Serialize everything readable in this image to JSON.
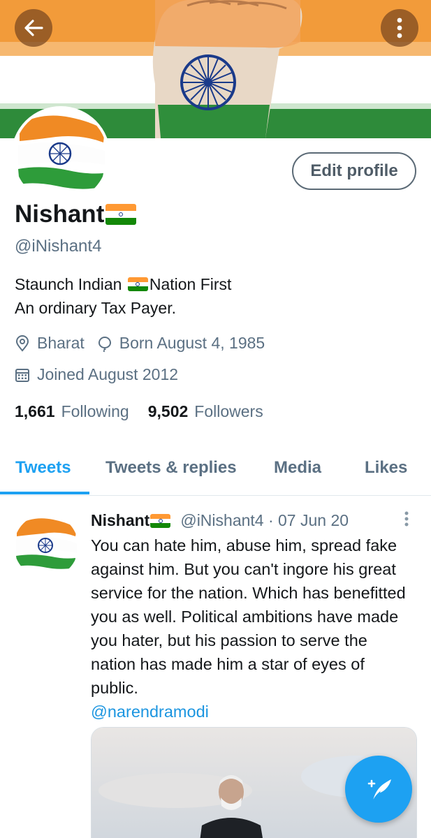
{
  "header": {
    "back_icon": "arrow-left-icon",
    "more_icon": "vertical-ellipsis-icon",
    "banner_colors": {
      "saffron": "#f29b3a",
      "white": "#ffffff",
      "green": "#2e8b3a"
    }
  },
  "profile": {
    "display_name": "Nishant",
    "name_emoji": "flag-india",
    "handle": "@iNishant4",
    "edit_button_label": "Edit profile",
    "bio_line1_part1": "Staunch Indian ",
    "bio_line1_part2": "Nation First",
    "bio_line2": "An ordinary Tax Payer.",
    "location": "Bharat",
    "birthday": "Born August 4, 1985",
    "joined": "Joined August 2012",
    "following_count": "1,661",
    "following_label": "Following",
    "followers_count": "9,502",
    "followers_label": "Followers"
  },
  "tabs": [
    {
      "label": "Tweets",
      "active": true
    },
    {
      "label": "Tweets & replies",
      "active": false
    },
    {
      "label": "Media",
      "active": false
    },
    {
      "label": "Likes",
      "active": false
    }
  ],
  "tweet": {
    "author_name": "Nishant",
    "author_handle_date": "@iNishant4 · 07 Jun 20",
    "text": "You can hate him, abuse him, spread fake against him. But you can't ingore his great service for the nation. Which has benefitted you as well. Political ambitions have made you hater, but his passion to serve the nation has made him a star of eyes of public.",
    "mention": "@narendramodi"
  },
  "fab": {
    "icon": "compose-feather-icon"
  },
  "colors": {
    "accent": "#1da1f2",
    "secondary_text": "#5b7083",
    "primary_text": "#14171a"
  }
}
